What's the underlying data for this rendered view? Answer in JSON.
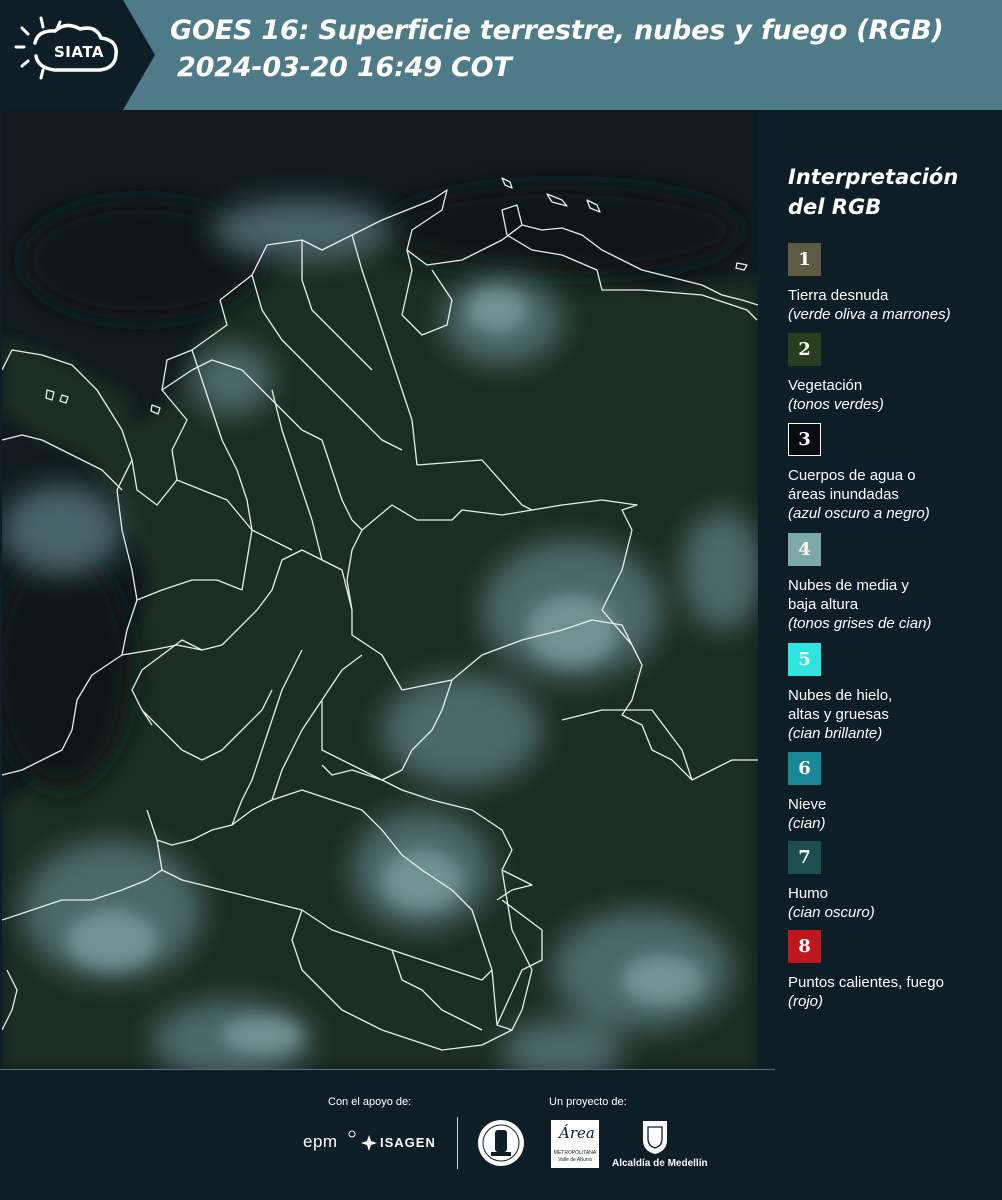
{
  "header": {
    "logo_text": "SIATA",
    "title_line1": "GOES 16: Superficie terrestre, nubes y fuego (RGB)",
    "title_line2": "2024-03-20 16:49 COT"
  },
  "legend": {
    "title": "Interpretación del RGB",
    "items": [
      {
        "num": "1",
        "color": "#5b5c43",
        "label": "Tierra desnuda",
        "note": "(verde oliva a marrones)"
      },
      {
        "num": "2",
        "color": "#2b3d20",
        "label": "Vegetación",
        "note": "(tonos verdes)"
      },
      {
        "num": "3",
        "color": "#0a0d10",
        "label": "Cuerpos de agua o\náreas inundadas",
        "note": "(azul oscuro a negro)"
      },
      {
        "num": "4",
        "color": "#7ea9a9",
        "label": "Nubes de media y\nbaja altura",
        "note": "(tonos grises de cian)"
      },
      {
        "num": "5",
        "color": "#2fe4e0",
        "label": "Nubes de hielo,\naltas y gruesas",
        "note": "(cian brillante)"
      },
      {
        "num": "6",
        "color": "#1a8798",
        "label": "Nieve",
        "note": "(cian)"
      },
      {
        "num": "7",
        "color": "#1c4f4e",
        "label": "Humo",
        "note": "(cian oscuro)"
      },
      {
        "num": "8",
        "color": "#c0171e",
        "label": "Puntos calientes, fuego",
        "note": "(rojo)"
      }
    ]
  },
  "footer": {
    "support_label": "Con el apoyo de:",
    "project_label": "Un proyecto de:",
    "sponsor_epm": "epm",
    "sponsor_isagen": "ISAGEN",
    "area_logo_text": "Área",
    "area_logo_sub1": "METROPOLITANA",
    "area_logo_sub2": "Valle de Aburrá",
    "alcaldia_text": "Alcaldía de Medellín"
  }
}
